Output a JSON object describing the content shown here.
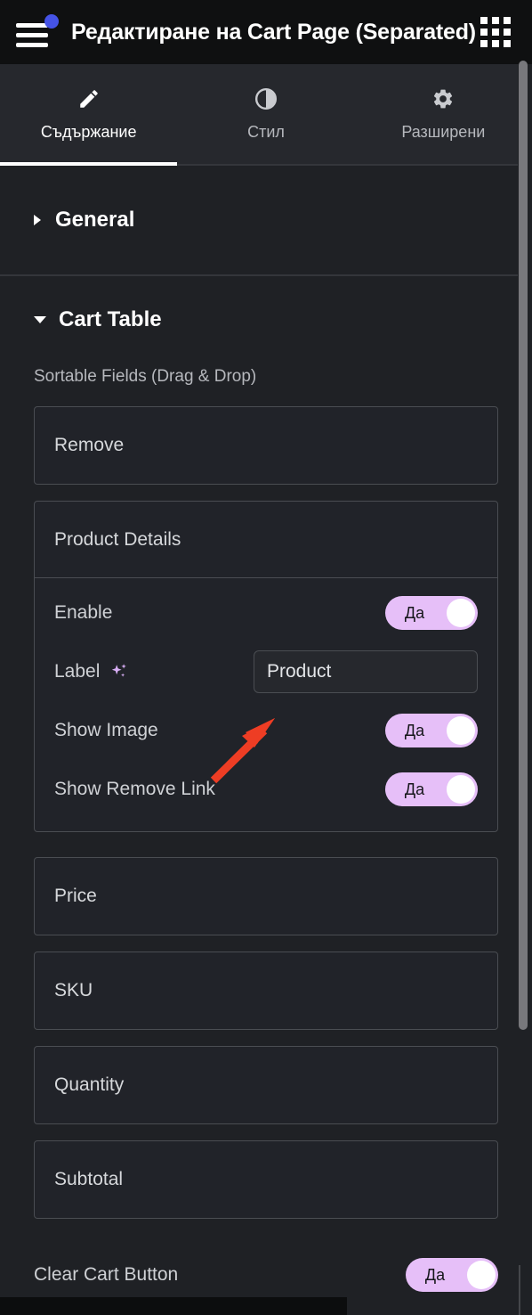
{
  "header": {
    "menu_icon": "hamburger-menu-icon",
    "notification_dot_color": "#4553e6",
    "title": "Редактиране на Cart Page (Separated)",
    "apps_icon": "apps-grid-icon"
  },
  "tabs": [
    {
      "label": "Съдържание",
      "icon": "pencil-icon",
      "active": true
    },
    {
      "label": "Стил",
      "icon": "contrast-icon",
      "active": false
    },
    {
      "label": "Разширени",
      "icon": "gear-icon",
      "active": false
    }
  ],
  "sections": [
    {
      "title": "General",
      "expanded": false,
      "caret": "chevron-right-icon"
    },
    {
      "title": "Cart Table",
      "expanded": true,
      "caret": "chevron-down-icon"
    }
  ],
  "cart_table": {
    "sortable_caption": "Sortable Fields (Drag & Drop)",
    "fields": [
      {
        "name": "Remove",
        "expanded": false
      },
      {
        "name": "Product Details",
        "expanded": true,
        "controls": {
          "enable": {
            "label": "Enable",
            "value": "Да"
          },
          "label": {
            "label": "Label",
            "ai_icon": "sparkle-ai-icon",
            "value": "Product"
          },
          "show_image": {
            "label": "Show Image",
            "value": "Да"
          },
          "show_remove_link": {
            "label": "Show Remove Link",
            "value": "Да"
          }
        }
      },
      {
        "name": "Price",
        "expanded": false
      },
      {
        "name": "SKU",
        "expanded": false
      },
      {
        "name": "Quantity",
        "expanded": false
      },
      {
        "name": "Subtotal",
        "expanded": false
      }
    ],
    "clear_cart_button": {
      "label": "Clear Cart Button",
      "value": "Да"
    }
  },
  "annotation": {
    "arrow_color": "#ee3d24",
    "points_to": "label-text-input"
  },
  "colors": {
    "toggle_on": "#e6bff8",
    "accent_blue": "#4553e6",
    "panel_bg": "#1f2125",
    "tabs_bg": "#26282d",
    "topbar_bg": "#0f1011"
  }
}
